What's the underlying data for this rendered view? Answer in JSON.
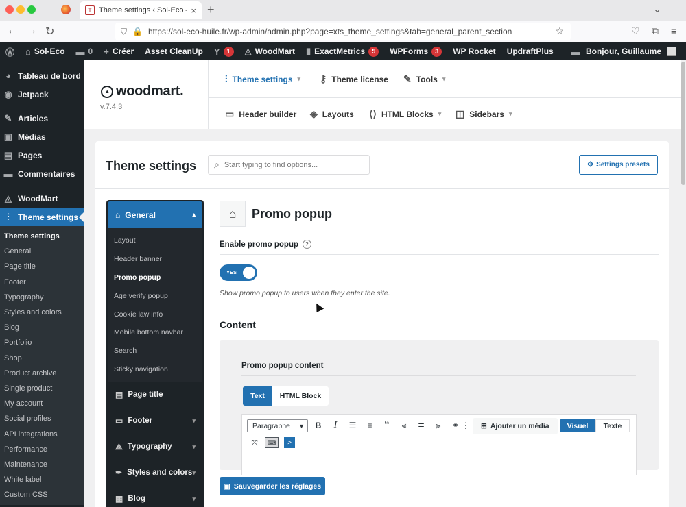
{
  "browser": {
    "tab_title": "Theme settings ‹ Sol-Eco — Wo",
    "tab_favicon": "T",
    "url": "https://sol-eco-huile.fr/wp-admin/admin.php?page=xts_theme_settings&tab=general_parent_section",
    "new_tab_icon": "+",
    "tab_list_icon": "⌄",
    "back_icon": "←",
    "forward_icon": "→",
    "reload_icon": "↻",
    "shield_icon": "⛉",
    "lock_icon": "🔒",
    "star_icon": "☆",
    "close_tab": "×"
  },
  "adminbar": {
    "wp_logo": "Ⓦ",
    "site_name": "Sol-Eco",
    "comments_count": "0",
    "create_label": "Créer",
    "asset_cleanup": "Asset CleanUp",
    "yoast_badge": "1",
    "woodmart": "WoodMart",
    "exactmetrics": "ExactMetrics",
    "exactmetrics_badge": "5",
    "wpforms": "WPForms",
    "wpforms_badge": "3",
    "wp_rocket": "WP Rocket",
    "updraftplus": "UpdraftPlus",
    "greeting": "Bonjour, Guillaume"
  },
  "sidebar": {
    "items": [
      {
        "label": "Tableau de bord",
        "icon": "◕"
      },
      {
        "label": "Jetpack",
        "icon": "◉"
      },
      {
        "label": "Articles",
        "icon": "✎"
      },
      {
        "label": "Médias",
        "icon": "▣"
      },
      {
        "label": "Pages",
        "icon": "▤"
      },
      {
        "label": "Commentaires",
        "icon": "▬"
      },
      {
        "label": "WoodMart",
        "icon": "◬"
      },
      {
        "label": "Theme settings",
        "icon": "⫶"
      }
    ],
    "sub": [
      "Theme settings",
      "General",
      "Page title",
      "Footer",
      "Typography",
      "Styles and colors",
      "Blog",
      "Portfolio",
      "Shop",
      "Product archive",
      "Single product",
      "My account",
      "Social profiles",
      "API integrations",
      "Performance",
      "Maintenance",
      "White label",
      "Custom CSS"
    ]
  },
  "wm": {
    "logo_text": "woodmart.",
    "version": "v.7.4.3",
    "nav_top": [
      {
        "label": "Theme settings",
        "icon": "⫶"
      },
      {
        "label": "Theme license",
        "icon": "⚷"
      },
      {
        "label": "Tools",
        "icon": "✎"
      }
    ],
    "nav_bottom": [
      {
        "label": "Header builder",
        "icon": "▭"
      },
      {
        "label": "Layouts",
        "icon": "◈"
      },
      {
        "label": "HTML Blocks",
        "icon": "⟨⟩"
      },
      {
        "label": "Sidebars",
        "icon": "◫"
      }
    ]
  },
  "panel": {
    "title": "Theme settings",
    "search_placeholder": "Start typing to find options...",
    "presets_label": "Settings presets",
    "presets_icon": "⚙"
  },
  "settings_nav": {
    "general": "General",
    "general_icon": "⌂",
    "sub": [
      "Layout",
      "Header banner",
      "Promo popup",
      "Age verify popup",
      "Cookie law info",
      "Mobile bottom navbar",
      "Search",
      "Sticky navigation"
    ],
    "sections": [
      {
        "label": "Page title",
        "icon": "▤"
      },
      {
        "label": "Footer",
        "icon": "▭"
      },
      {
        "label": "Typography",
        "icon": "⟁"
      },
      {
        "label": "Styles and colors",
        "icon": "✒"
      },
      {
        "label": "Blog",
        "icon": "▦"
      }
    ]
  },
  "section": {
    "title": "Promo popup",
    "home_icon": "⌂",
    "enable_label": "Enable promo popup",
    "toggle_value": "YES",
    "toggle_desc": "Show promo popup to users when they enter the site.",
    "content_heading": "Content",
    "pp_label": "Promo popup content",
    "tab_text": "Text",
    "tab_html": "HTML Block",
    "format_value": "Paragraphe",
    "add_media": "Ajouter un média",
    "mode_visual": "Visuel",
    "mode_texte": "Texte",
    "save_label": "Sauvegarder les réglages"
  },
  "colors": {
    "accent": "#2271b1",
    "admin_bar": "#1d2327",
    "badge": "#d63638"
  }
}
